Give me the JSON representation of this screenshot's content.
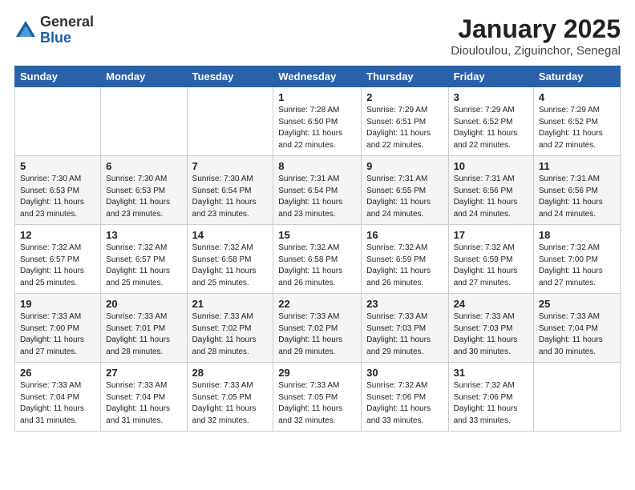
{
  "logo": {
    "general": "General",
    "blue": "Blue"
  },
  "header": {
    "month": "January 2025",
    "location": "Diouloulou, Ziguinchor, Senegal"
  },
  "days_of_week": [
    "Sunday",
    "Monday",
    "Tuesday",
    "Wednesday",
    "Thursday",
    "Friday",
    "Saturday"
  ],
  "weeks": [
    [
      {
        "day": "",
        "info": ""
      },
      {
        "day": "",
        "info": ""
      },
      {
        "day": "",
        "info": ""
      },
      {
        "day": "1",
        "info": "Sunrise: 7:28 AM\nSunset: 6:50 PM\nDaylight: 11 hours\nand 22 minutes."
      },
      {
        "day": "2",
        "info": "Sunrise: 7:29 AM\nSunset: 6:51 PM\nDaylight: 11 hours\nand 22 minutes."
      },
      {
        "day": "3",
        "info": "Sunrise: 7:29 AM\nSunset: 6:52 PM\nDaylight: 11 hours\nand 22 minutes."
      },
      {
        "day": "4",
        "info": "Sunrise: 7:29 AM\nSunset: 6:52 PM\nDaylight: 11 hours\nand 22 minutes."
      }
    ],
    [
      {
        "day": "5",
        "info": "Sunrise: 7:30 AM\nSunset: 6:53 PM\nDaylight: 11 hours\nand 23 minutes."
      },
      {
        "day": "6",
        "info": "Sunrise: 7:30 AM\nSunset: 6:53 PM\nDaylight: 11 hours\nand 23 minutes."
      },
      {
        "day": "7",
        "info": "Sunrise: 7:30 AM\nSunset: 6:54 PM\nDaylight: 11 hours\nand 23 minutes."
      },
      {
        "day": "8",
        "info": "Sunrise: 7:31 AM\nSunset: 6:54 PM\nDaylight: 11 hours\nand 23 minutes."
      },
      {
        "day": "9",
        "info": "Sunrise: 7:31 AM\nSunset: 6:55 PM\nDaylight: 11 hours\nand 24 minutes."
      },
      {
        "day": "10",
        "info": "Sunrise: 7:31 AM\nSunset: 6:56 PM\nDaylight: 11 hours\nand 24 minutes."
      },
      {
        "day": "11",
        "info": "Sunrise: 7:31 AM\nSunset: 6:56 PM\nDaylight: 11 hours\nand 24 minutes."
      }
    ],
    [
      {
        "day": "12",
        "info": "Sunrise: 7:32 AM\nSunset: 6:57 PM\nDaylight: 11 hours\nand 25 minutes."
      },
      {
        "day": "13",
        "info": "Sunrise: 7:32 AM\nSunset: 6:57 PM\nDaylight: 11 hours\nand 25 minutes."
      },
      {
        "day": "14",
        "info": "Sunrise: 7:32 AM\nSunset: 6:58 PM\nDaylight: 11 hours\nand 25 minutes."
      },
      {
        "day": "15",
        "info": "Sunrise: 7:32 AM\nSunset: 6:58 PM\nDaylight: 11 hours\nand 26 minutes."
      },
      {
        "day": "16",
        "info": "Sunrise: 7:32 AM\nSunset: 6:59 PM\nDaylight: 11 hours\nand 26 minutes."
      },
      {
        "day": "17",
        "info": "Sunrise: 7:32 AM\nSunset: 6:59 PM\nDaylight: 11 hours\nand 27 minutes."
      },
      {
        "day": "18",
        "info": "Sunrise: 7:32 AM\nSunset: 7:00 PM\nDaylight: 11 hours\nand 27 minutes."
      }
    ],
    [
      {
        "day": "19",
        "info": "Sunrise: 7:33 AM\nSunset: 7:00 PM\nDaylight: 11 hours\nand 27 minutes."
      },
      {
        "day": "20",
        "info": "Sunrise: 7:33 AM\nSunset: 7:01 PM\nDaylight: 11 hours\nand 28 minutes."
      },
      {
        "day": "21",
        "info": "Sunrise: 7:33 AM\nSunset: 7:02 PM\nDaylight: 11 hours\nand 28 minutes."
      },
      {
        "day": "22",
        "info": "Sunrise: 7:33 AM\nSunset: 7:02 PM\nDaylight: 11 hours\nand 29 minutes."
      },
      {
        "day": "23",
        "info": "Sunrise: 7:33 AM\nSunset: 7:03 PM\nDaylight: 11 hours\nand 29 minutes."
      },
      {
        "day": "24",
        "info": "Sunrise: 7:33 AM\nSunset: 7:03 PM\nDaylight: 11 hours\nand 30 minutes."
      },
      {
        "day": "25",
        "info": "Sunrise: 7:33 AM\nSunset: 7:04 PM\nDaylight: 11 hours\nand 30 minutes."
      }
    ],
    [
      {
        "day": "26",
        "info": "Sunrise: 7:33 AM\nSunset: 7:04 PM\nDaylight: 11 hours\nand 31 minutes."
      },
      {
        "day": "27",
        "info": "Sunrise: 7:33 AM\nSunset: 7:04 PM\nDaylight: 11 hours\nand 31 minutes."
      },
      {
        "day": "28",
        "info": "Sunrise: 7:33 AM\nSunset: 7:05 PM\nDaylight: 11 hours\nand 32 minutes."
      },
      {
        "day": "29",
        "info": "Sunrise: 7:33 AM\nSunset: 7:05 PM\nDaylight: 11 hours\nand 32 minutes."
      },
      {
        "day": "30",
        "info": "Sunrise: 7:32 AM\nSunset: 7:06 PM\nDaylight: 11 hours\nand 33 minutes."
      },
      {
        "day": "31",
        "info": "Sunrise: 7:32 AM\nSunset: 7:06 PM\nDaylight: 11 hours\nand 33 minutes."
      },
      {
        "day": "",
        "info": ""
      }
    ]
  ]
}
